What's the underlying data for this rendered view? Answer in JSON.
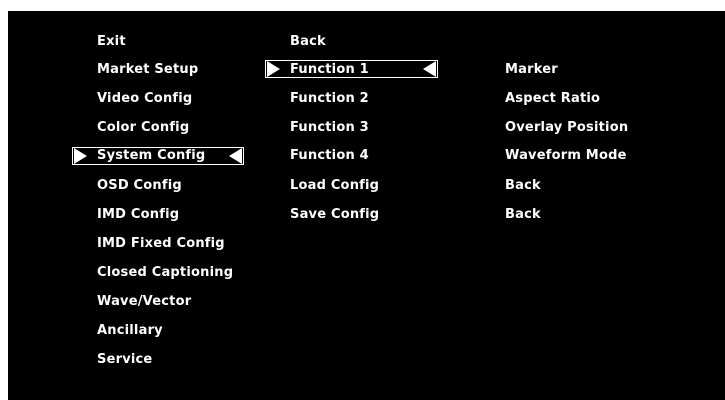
{
  "menu": {
    "col1": [
      "Exit",
      "Market Setup",
      "Video Config",
      "Color Config",
      "System Config",
      "OSD Config",
      "IMD Config",
      "IMD Fixed Config",
      "Closed Captioning",
      "Wave/Vector",
      "Ancillary",
      "Service"
    ],
    "col2": [
      "Back",
      "Function 1",
      "Function 2",
      "Function 3",
      "Function 4",
      "Load Config",
      "Save Config"
    ],
    "col3": [
      "Marker",
      "Aspect Ratio",
      "Overlay Position",
      "Waveform Mode",
      "Back",
      "Back"
    ]
  },
  "selection": {
    "col1_selected": "System Config",
    "col2_selected": "Function 1"
  },
  "colors": {
    "background": "#000000",
    "text": "#ffffff"
  },
  "icons": {
    "selection_arrow_right": "triangle-right",
    "selection_arrow_left": "triangle-left"
  }
}
